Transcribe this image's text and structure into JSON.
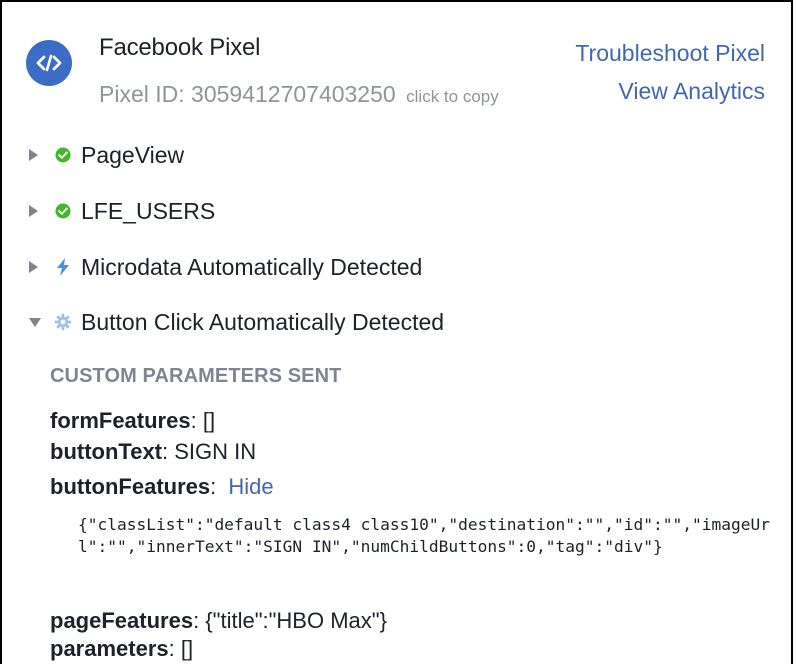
{
  "header": {
    "title": "Facebook Pixel",
    "pixel_id_label": "Pixel ID: 3059412707403250",
    "copy_hint": "click to copy",
    "troubleshoot_link": "Troubleshoot Pixel",
    "analytics_link": "View Analytics",
    "logo_icon": "code-brackets-icon",
    "accent_color": "#3b6dc4"
  },
  "events": [
    {
      "label": "PageView",
      "status_icon": "green-check-icon",
      "expanded": false
    },
    {
      "label": "LFE_USERS",
      "status_icon": "green-check-icon",
      "expanded": false
    },
    {
      "label": "Microdata Automatically Detected",
      "status_icon": "lightning-icon",
      "expanded": false
    },
    {
      "label": "Button Click Automatically Detected",
      "status_icon": "gear-icon",
      "expanded": true
    }
  ],
  "details": {
    "section_title": "CUSTOM PARAMETERS SENT",
    "params": [
      {
        "key": "formFeatures",
        "sep": ": ",
        "value": "[]"
      },
      {
        "key": "buttonText",
        "sep": ": ",
        "value": "SIGN IN"
      },
      {
        "key": "buttonFeatures",
        "sep": ": ",
        "action": "Hide"
      },
      {
        "key": "pageFeatures",
        "sep": ": ",
        "value": "{\"title\":\"HBO Max\"}"
      },
      {
        "key": "parameters",
        "sep": ": ",
        "value": "[]"
      }
    ],
    "button_features_json": "{\"classList\":\"default class4 class10\",\"destination\":\"\",\"id\":\"\",\"imageUrl\":\"\",\"innerText\":\"SIGN IN\",\"numChildButtons\":0,\"tag\":\"div\"}"
  }
}
